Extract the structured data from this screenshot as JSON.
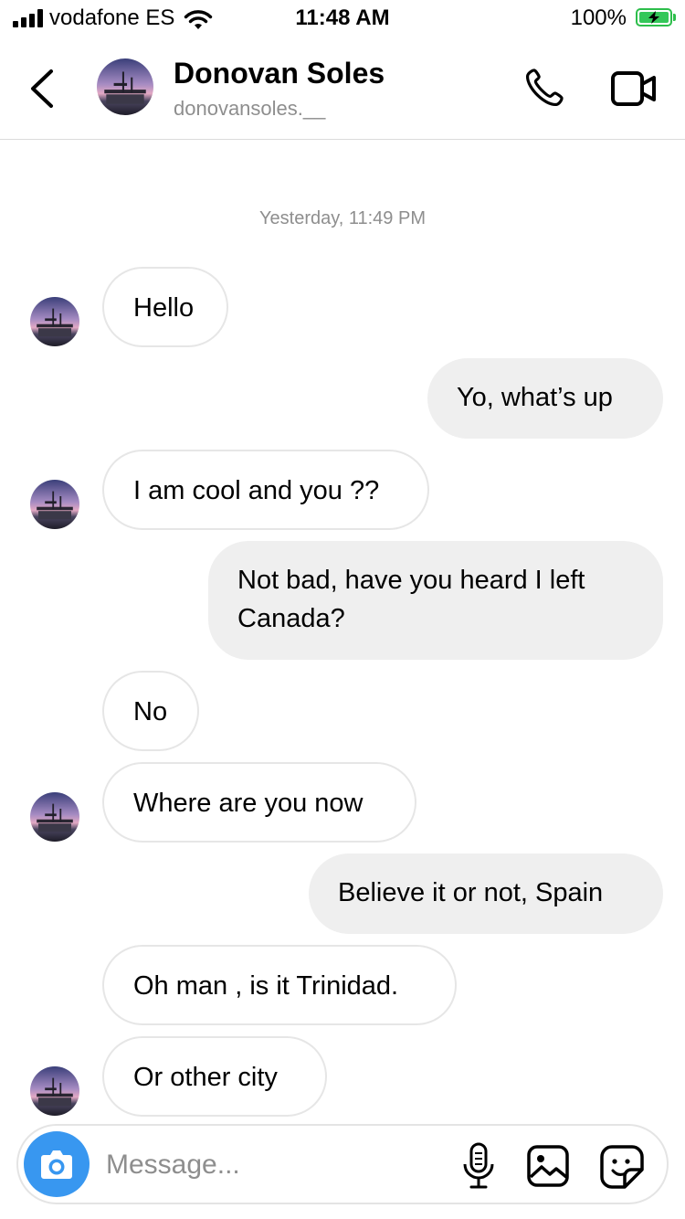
{
  "status_bar": {
    "carrier": "vodafone ES",
    "time": "11:48 AM",
    "battery": "100%"
  },
  "header": {
    "name": "Donovan Soles",
    "username": "donovansoles.__"
  },
  "timestamp": "Yesterday, 11:49 PM",
  "messages": [
    {
      "text": "Hello",
      "direction": "incoming"
    },
    {
      "text": "Yo, what’s up",
      "direction": "outgoing"
    },
    {
      "text": "I am cool and you ??",
      "direction": "incoming"
    },
    {
      "text": "Not bad, have you heard I left Canada?",
      "direction": "outgoing"
    },
    {
      "text": "No",
      "direction": "incoming"
    },
    {
      "text": "Where are you now",
      "direction": "incoming"
    },
    {
      "text": "Believe it or not, Spain",
      "direction": "outgoing"
    },
    {
      "text": "Oh man , is it Trinidad.",
      "direction": "incoming"
    },
    {
      "text": "Or other city",
      "direction": "incoming"
    }
  ],
  "composer": {
    "placeholder": "Message...",
    "icons": [
      "camera-icon",
      "microphone-icon",
      "gallery-icon",
      "sticker-icon"
    ]
  },
  "colors": {
    "accent": "#3897f0",
    "outgoing_bubble": "#efefef",
    "incoming_border": "#e6e6e6",
    "battery": "#34c759"
  }
}
